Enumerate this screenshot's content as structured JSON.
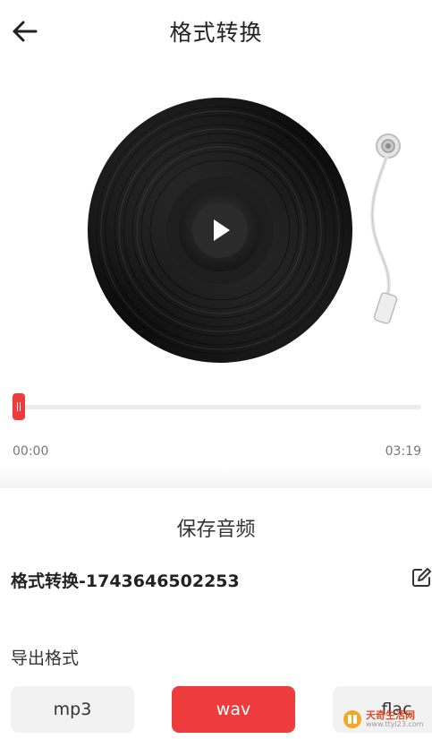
{
  "header": {
    "title": "格式转换",
    "back_icon": "arrow-left-icon"
  },
  "player": {
    "play_icon": "play-icon",
    "progress_fraction": 0.0,
    "current_time": "00:00",
    "total_time": "03:19",
    "accent_color": "#ee3c3c"
  },
  "save_panel": {
    "title": "保存音频",
    "filename": "格式转换-1743646502253",
    "edit_icon": "edit-icon",
    "export_label": "导出格式",
    "formats": [
      {
        "label": "mp3",
        "selected": false
      },
      {
        "label": "wav",
        "selected": true
      },
      {
        "label": "flac",
        "selected": false
      }
    ]
  },
  "watermark": {
    "text": "天奇生活网",
    "url": "www.ttyl23.com"
  }
}
